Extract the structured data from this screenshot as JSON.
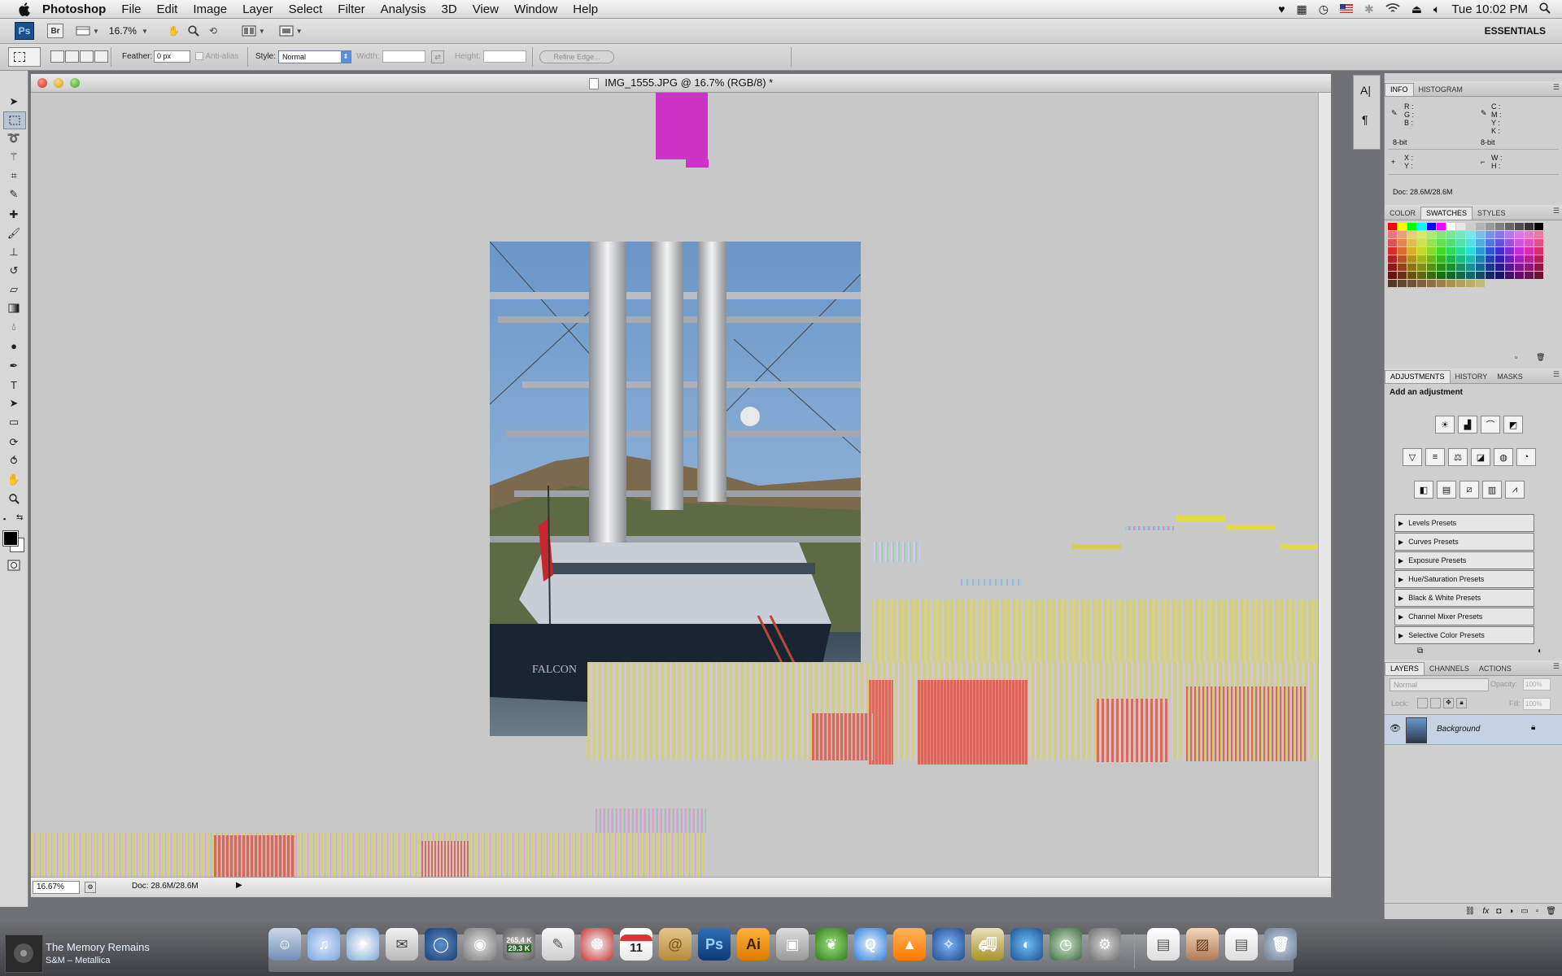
{
  "menubar": {
    "app_name": "Photoshop",
    "items": [
      "File",
      "Edit",
      "Image",
      "Layer",
      "Select",
      "Filter",
      "Analysis",
      "3D",
      "View",
      "Window",
      "Help"
    ],
    "clock": "Tue 10:02 PM"
  },
  "appbar": {
    "ps_logo": "Ps",
    "br_logo": "Br",
    "zoom": "16.7%",
    "workspace": "ESSENTIALS"
  },
  "options": {
    "feather_label": "Feather:",
    "feather_value": "0 px",
    "antialias_label": "Anti-alias",
    "style_label": "Style:",
    "style_value": "Normal",
    "width_label": "Width:",
    "height_label": "Height:",
    "refine_edge": "Refine Edge..."
  },
  "document": {
    "title": "IMG_1555.JPG @ 16.7% (RGB/8) *",
    "zoom_value": "16.67%",
    "doc_size": "Doc: 28.6M/28.6M",
    "photo_text": "FALCON"
  },
  "info_panel": {
    "tabs": [
      "INFO",
      "HISTOGRAM"
    ],
    "r": "R :",
    "g": "G :",
    "b": "B :",
    "c": "C :",
    "m": "M :",
    "y": "Y :",
    "k": "K :",
    "bit_left": "8-bit",
    "bit_right": "8-bit",
    "x": "X :",
    "y_pos": "Y :",
    "w": "W :",
    "h": "H :",
    "doc": "Doc: 28.6M/28.6M"
  },
  "swatch_panel": {
    "tabs": [
      "COLOR",
      "SWATCHES",
      "STYLES"
    ]
  },
  "adjust_panel": {
    "tabs": [
      "ADJUSTMENTS",
      "HISTORY",
      "MASKS"
    ],
    "heading": "Add an adjustment",
    "presets": [
      "Levels Presets",
      "Curves Presets",
      "Exposure Presets",
      "Hue/Saturation Presets",
      "Black & White Presets",
      "Channel Mixer Presets",
      "Selective Color Presets"
    ]
  },
  "layers_panel": {
    "tabs": [
      "LAYERS",
      "CHANNELS",
      "ACTIONS"
    ],
    "blend_mode": "Normal",
    "opacity_label": "Opacity:",
    "opacity_value": "100%",
    "lock_label": "Lock:",
    "fill_label": "Fill:",
    "fill_value": "100%",
    "layer_name": "Background"
  },
  "dock": {
    "now_playing_title": "The Memory Remains",
    "now_playing_artist": "S&M – Metallica",
    "net_up": "265.4 K",
    "net_down": "29.3 K",
    "calendar_day": "11",
    "ps_label": "Ps",
    "ai_label": "Ai"
  }
}
